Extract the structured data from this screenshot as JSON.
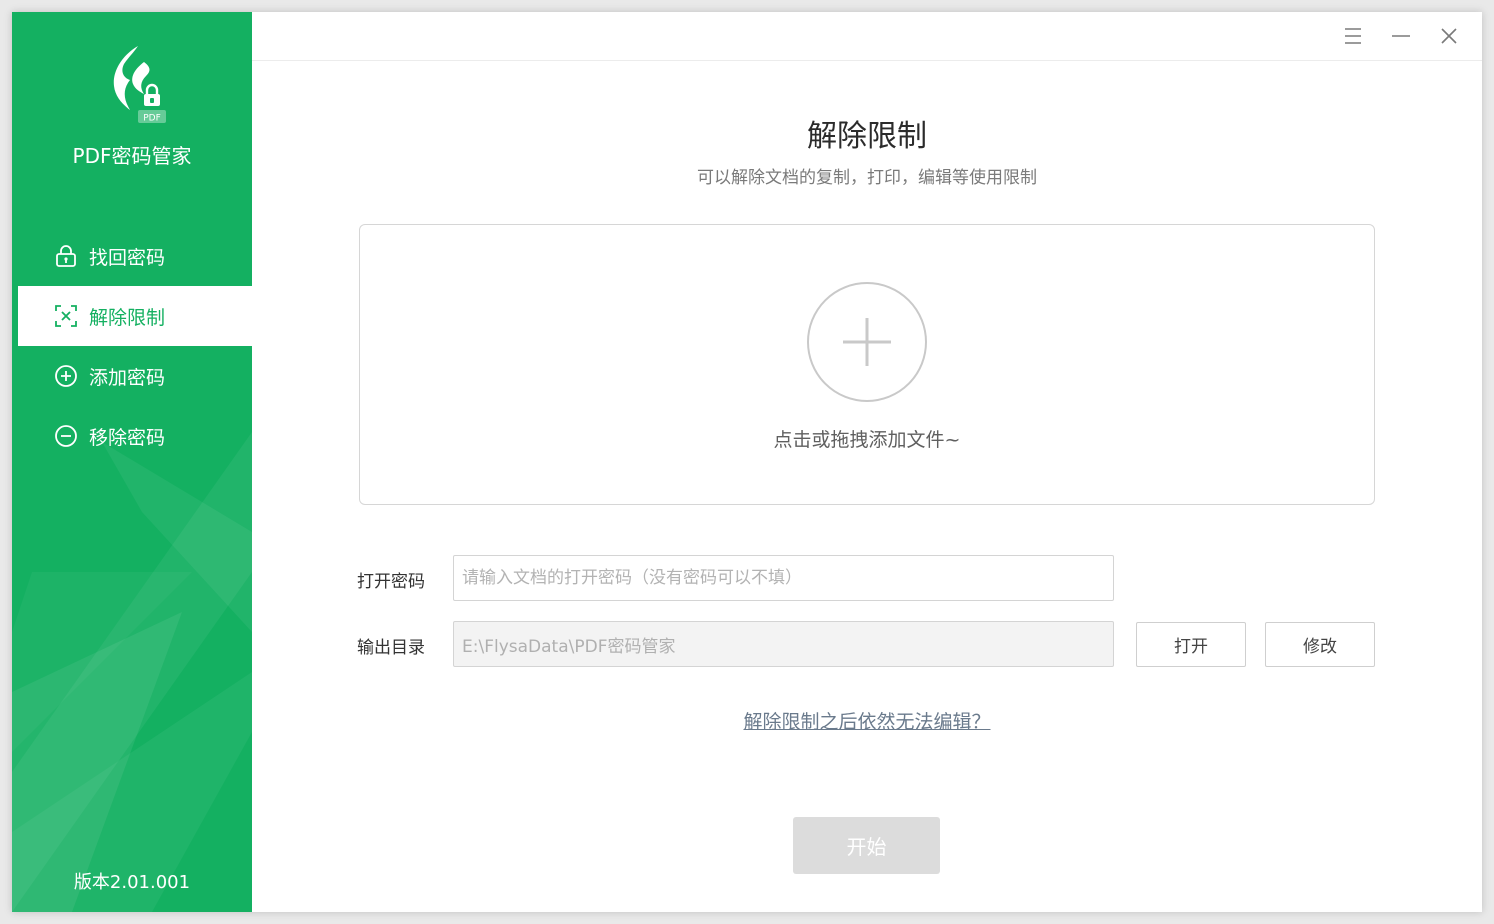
{
  "app": {
    "name": "PDF密码管家",
    "logo_badge": "PDF",
    "version": "版本2.01.001"
  },
  "colors": {
    "brand": "#14b061",
    "sidebar_text": "#ffffff",
    "start_disabled": "#dcdcdc",
    "link": "#6a7a8c"
  },
  "sidebar": {
    "items": [
      {
        "label": "找回密码",
        "icon": "lock-icon",
        "active": false
      },
      {
        "label": "解除限制",
        "icon": "unrestrict-icon",
        "active": true
      },
      {
        "label": "添加密码",
        "icon": "plus-circle-icon",
        "active": false
      },
      {
        "label": "移除密码",
        "icon": "minus-circle-icon",
        "active": false
      }
    ]
  },
  "titlebar": {
    "buttons": [
      "menu-icon",
      "minimize-icon",
      "close-icon"
    ]
  },
  "main": {
    "title": "解除限制",
    "subtitle": "可以解除文档的复制，打印，编辑等使用限制",
    "dropzone": {
      "icon": "plus-icon",
      "hint": "点击或拖拽添加文件~"
    },
    "form": {
      "password_label": "打开密码",
      "password_value": "",
      "password_placeholder": "请输入文档的打开密码（没有密码可以不填）",
      "output_label": "输出目录",
      "output_value": "E:\\FlysaData\\PDF密码管家",
      "open_button": "打开",
      "modify_button": "修改"
    },
    "help_link": "解除限制之后依然无法编辑？",
    "start_button": "开始"
  }
}
